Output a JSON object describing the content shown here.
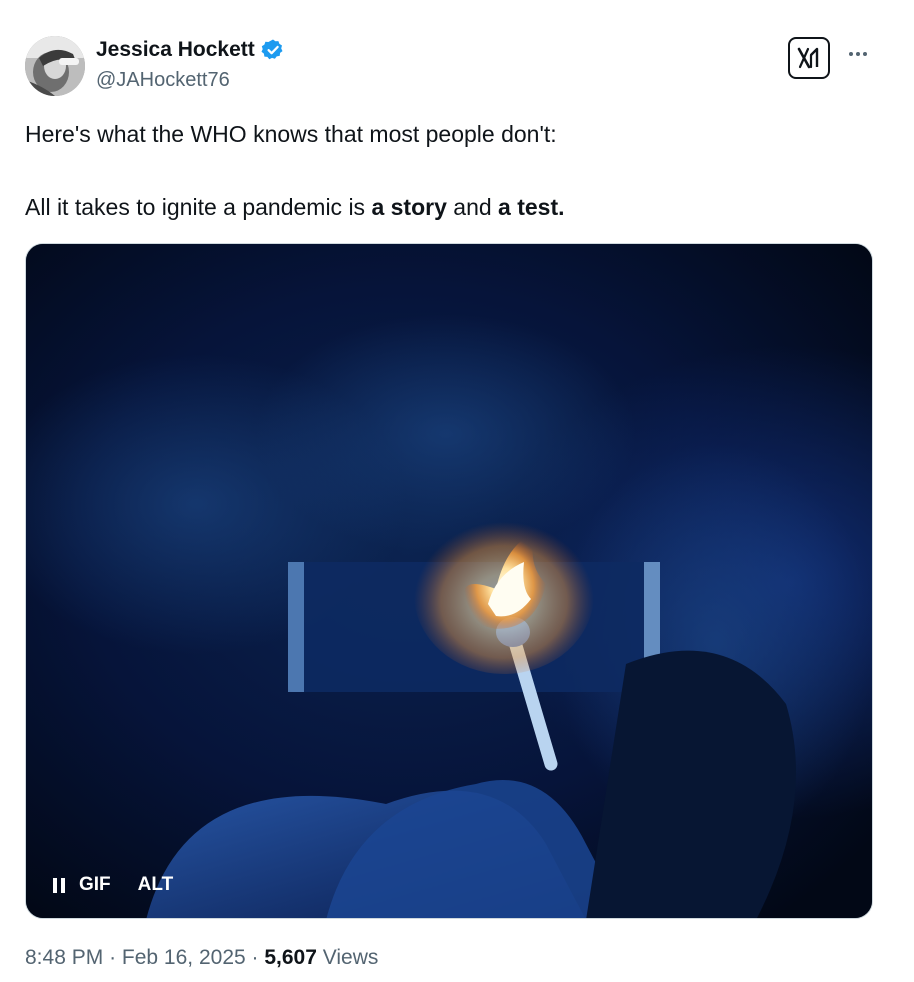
{
  "author": {
    "display_name": "Jessica Hockett",
    "handle": "@JAHockett76",
    "verified_icon": "verified-badge-icon",
    "avatar_icon": "avatar"
  },
  "header_actions": {
    "x_logo_icon": "x-logo-icon",
    "more_icon": "more-horizontal-icon"
  },
  "tweet": {
    "line1": "Here's what the WHO knows that most people don't:",
    "line2_prefix": "All it takes to ignite a pandemic is ",
    "line2_bold1": "a story",
    "line2_middle": " and ",
    "line2_bold2": "a test."
  },
  "media": {
    "type": "gif",
    "gif_label": "GIF",
    "alt_label": "ALT",
    "pause_icon": "pause-icon"
  },
  "meta": {
    "time": "8:48 PM",
    "separator": "·",
    "date": "Feb 16, 2025",
    "views_count": "5,607",
    "views_label": "Views"
  },
  "colors": {
    "text_primary": "#0f1419",
    "text_secondary": "#536471",
    "verified_blue": "#1d9bf0",
    "media_border": "#cfd9de"
  }
}
